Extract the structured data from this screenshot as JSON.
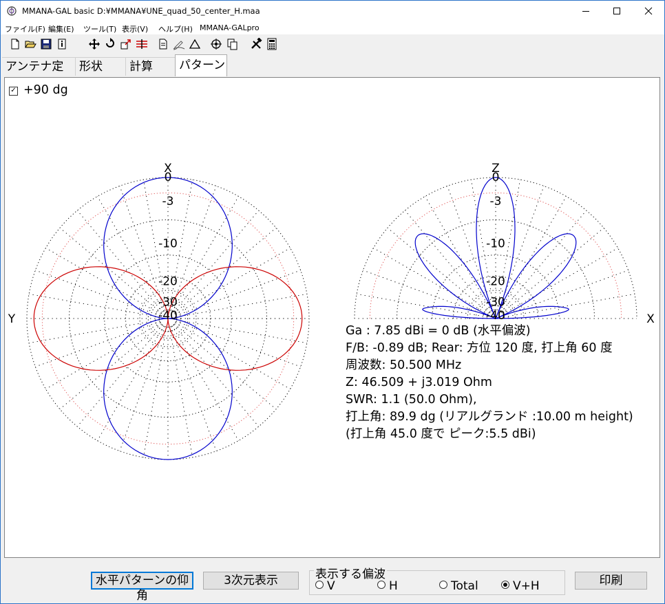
{
  "window": {
    "title": "MMANA-GAL basic  D:¥MMANA¥UNE_quad_50_center_H.maa"
  },
  "menu": {
    "items": [
      "ファイル(F)",
      "編集(E)",
      "ツール(T)",
      "表示(V)",
      "ヘルプ(H)",
      "MMANA-GALpro"
    ]
  },
  "toolbar": {
    "icons": [
      "new-file-icon",
      "open-folder-icon",
      "save-icon",
      "info-icon",
      "move-icon",
      "rotate-icon",
      "resize-icon",
      "split-icon",
      "document-icon",
      "pen-icon",
      "triangle-icon",
      "crosshair-icon",
      "copy-icon",
      "tools-icon",
      "calculator-icon"
    ]
  },
  "tabs": [
    {
      "label": "アンテナ定義",
      "active": false
    },
    {
      "label": "形状",
      "active": false
    },
    {
      "label": "計算",
      "active": false
    },
    {
      "label": "パターン",
      "active": true
    }
  ],
  "pattern": {
    "checkbox_label": "+90 dg",
    "checkbox_checked": true,
    "horizontal_plot": {
      "top_axis": "X",
      "left_axis": "Y",
      "ring_labels": [
        "0",
        "-3",
        "-10",
        "-20",
        "-30",
        "-40"
      ],
      "traces": [
        {
          "name": "V",
          "color": "#0000cc"
        },
        {
          "name": "H",
          "color": "#cc0000"
        }
      ]
    },
    "vertical_plot": {
      "top_axis": "Z",
      "right_axis": "X",
      "ring_labels": [
        "0",
        "-3",
        "-10",
        "-20",
        "-30",
        "-40"
      ]
    },
    "results": [
      "Ga : 7.85 dBi = 0 dB  (水平偏波)",
      "F/B: -0.89 dB; Rear: 方位 120 度,  打上角 60 度",
      "周波数: 50.500 MHz",
      "Z: 46.509 + j3.019 Ohm",
      "SWR: 1.1 (50.0 Ohm),",
      "打上角: 89.9 dg (リアルグランド  :10.00 m height)",
      "(打上角 45.0 度で ピーク:5.5 dBi)"
    ]
  },
  "bottom": {
    "elevation_button": "水平パターンの仰角",
    "three_d_button": "3次元表示",
    "polarization_group": "表示する偏波",
    "radios": [
      {
        "label": "V",
        "checked": false
      },
      {
        "label": "H",
        "checked": false
      },
      {
        "label": "Total",
        "checked": false
      },
      {
        "label": "V+H",
        "checked": true
      }
    ],
    "print_button": "印刷"
  }
}
